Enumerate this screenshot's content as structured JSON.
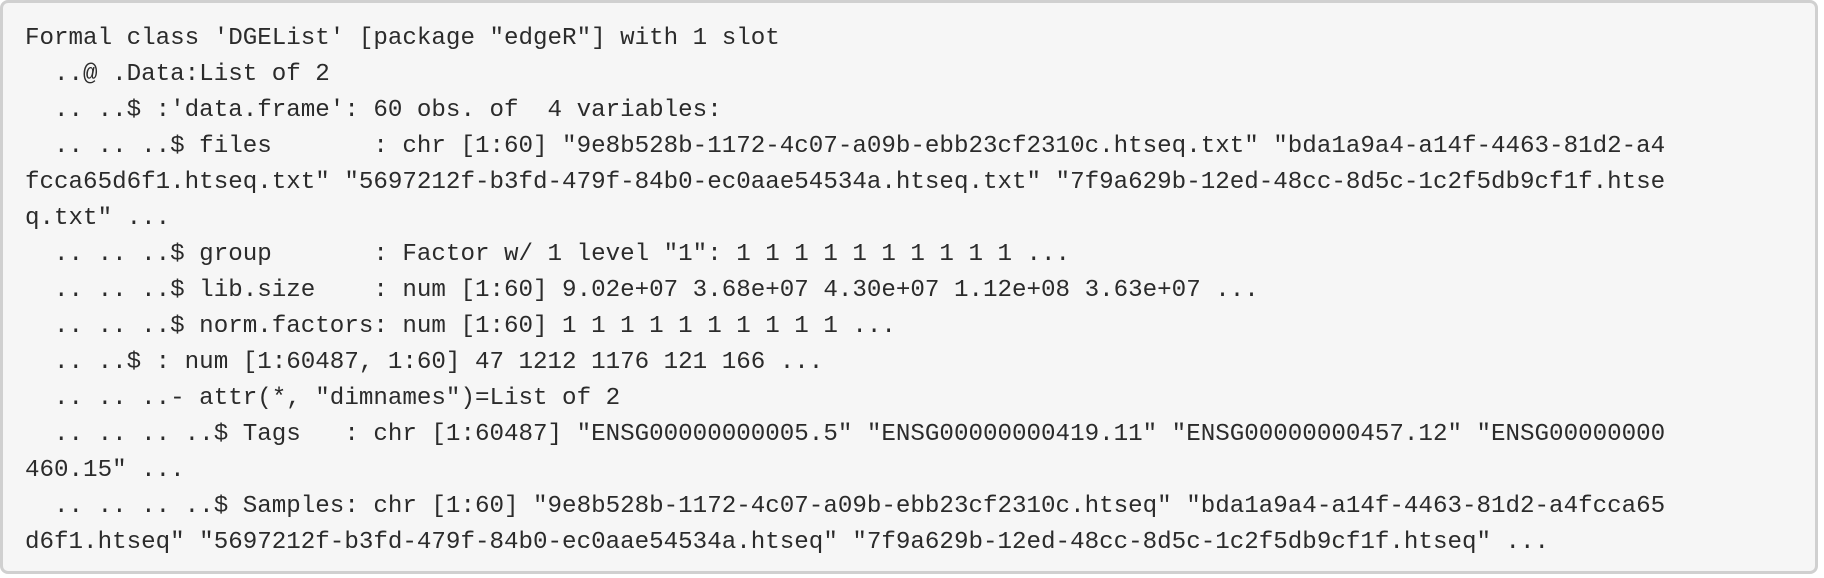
{
  "console_output": {
    "lines": [
      "Formal class 'DGEList' [package \"edgeR\"] with 1 slot",
      "  ..@ .Data:List of 2",
      "  .. ..$ :'data.frame': 60 obs. of  4 variables:",
      "  .. .. ..$ files       : chr [1:60] \"9e8b528b-1172-4c07-a09b-ebb23cf2310c.htseq.txt\" \"bda1a9a4-a14f-4463-81d2-a4",
      "fcca65d6f1.htseq.txt\" \"5697212f-b3fd-479f-84b0-ec0aae54534a.htseq.txt\" \"7f9a629b-12ed-48cc-8d5c-1c2f5db9cf1f.htse",
      "q.txt\" ...",
      "  .. .. ..$ group       : Factor w/ 1 level \"1\": 1 1 1 1 1 1 1 1 1 1 ...",
      "  .. .. ..$ lib.size    : num [1:60] 9.02e+07 3.68e+07 4.30e+07 1.12e+08 3.63e+07 ...",
      "  .. .. ..$ norm.factors: num [1:60] 1 1 1 1 1 1 1 1 1 1 ...",
      "  .. ..$ : num [1:60487, 1:60] 47 1212 1176 121 166 ...",
      "  .. .. ..- attr(*, \"dimnames\")=List of 2",
      "  .. .. .. ..$ Tags   : chr [1:60487] \"ENSG00000000005.5\" \"ENSG00000000419.11\" \"ENSG00000000457.12\" \"ENSG00000000",
      "460.15\" ...",
      "  .. .. .. ..$ Samples: chr [1:60] \"9e8b528b-1172-4c07-a09b-ebb23cf2310c.htseq\" \"bda1a9a4-a14f-4463-81d2-a4fcca65",
      "d6f1.htseq\" \"5697212f-b3fd-479f-84b0-ec0aae54534a.htseq\" \"7f9a629b-12ed-48cc-8d5c-1c2f5db9cf1f.htseq\" ..."
    ]
  }
}
